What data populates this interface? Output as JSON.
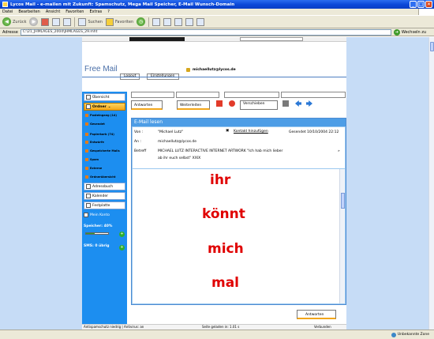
{
  "window": {
    "title": "Lycos Mail - e-mailen mit Zukunft: Spamschutz, Mega Mail Speicher, E-Mail Wunsch-Domain",
    "buttons": [
      "_",
      "□",
      "✕"
    ]
  },
  "menu": [
    "Datei",
    "Bearbeiten",
    "Ansicht",
    "Favoriten",
    "Extras",
    "?"
  ],
  "toolbar": {
    "back": "Zurück",
    "search": "Suchen",
    "favorites": "Favoriten"
  },
  "address": {
    "label": "Adresse",
    "value": "C:\\21_JHMLAGES_2004\\JHMLAGES_29.mht",
    "go_label": "Wechseln zu"
  },
  "header": {
    "brand": "Free Mail",
    "logout": "Logout",
    "settings": "Einstellungen",
    "user": "michaellutz@lycos.de"
  },
  "sidebar": {
    "overview": "Übersicht",
    "folders_label": "Ordner",
    "folders": [
      "Posteingang (14)",
      "Gesendet",
      "Papierkorb (74)",
      "Entwürfe",
      "Gespeicherte Mails",
      "Spam",
      "Externe",
      "Ordnerübersicht"
    ],
    "address_book": "Adressbuch",
    "calendar": "Kalender",
    "disk": "Festplatte",
    "account": "Mein Konto",
    "storage_label": "Speicher: 40%",
    "storage_pct": 0.4,
    "sms_label": "SMS: 0 übrig"
  },
  "actions": {
    "reply": "Antworten",
    "forward": "Weiterleiten",
    "move": "Verschieben"
  },
  "message": {
    "panel_title": "E-Mail lesen",
    "from_label": "Von :",
    "from_value": "\"Michael Lutz\"",
    "add_contact": "Kontakt hinzufügen",
    "date": "Gesendet 10/10/2004 22:12",
    "to_label": "An :",
    "to_value": "michaellutz@lycos.de",
    "subject_label": "Betreff",
    "subject_value_1": "MICHAEL LUTZ INTERACTIVE INTERNET ARTWORK \"Ich hab mich lieber",
    "subject_value_2": "ab ihr euch selbst\" XXIX",
    "body_words": [
      "ihr",
      "könnt",
      "mich",
      "mal"
    ]
  },
  "bottom": {
    "reply": "Antworten"
  },
  "footer": {
    "left": "Antispamschutz niedrig  |  Antivirus: an",
    "mid": "Seite geladen in: 1.01 s",
    "right": "Verbunden"
  },
  "status": {
    "zone": "Unbekannte Zone"
  }
}
